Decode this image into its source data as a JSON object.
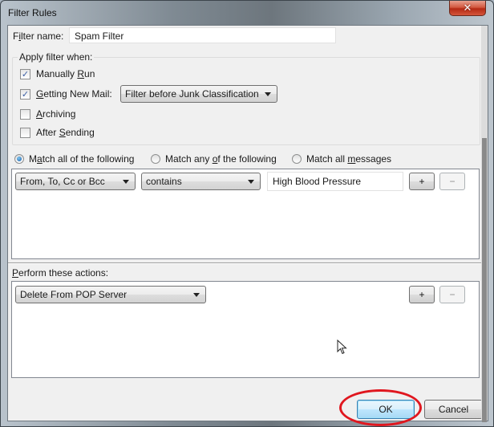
{
  "window": {
    "title": "Filter Rules",
    "close_icon": "close-x-icon",
    "close_glyph": "✕"
  },
  "filter_name": {
    "label_prefix": "F",
    "label_underlined": "i",
    "label_suffix": "lter name:",
    "value": "Spam Filter"
  },
  "apply_when": {
    "legend": "Apply filter when:",
    "options": [
      {
        "pre": "Manually ",
        "u": "R",
        "post": "un",
        "checked": true
      },
      {
        "pre": "",
        "u": "G",
        "post": "etting New Mail:",
        "checked": true
      },
      {
        "pre": "",
        "u": "A",
        "post": "rchiving",
        "checked": false
      },
      {
        "pre": "After ",
        "u": "S",
        "post": "ending",
        "checked": false
      }
    ],
    "new_mail_dropdown": "Filter before Junk Classification",
    "check_glyph": "✓"
  },
  "match": {
    "options": [
      {
        "pre": "M",
        "u": "a",
        "post": "tch all of the following",
        "selected": true
      },
      {
        "pre": "Match any ",
        "u": "o",
        "post": "f the following",
        "selected": false
      },
      {
        "pre": "Match all ",
        "u": "m",
        "post": "essages",
        "selected": false
      }
    ]
  },
  "rules": [
    {
      "field": "From, To, Cc or Bcc",
      "operator": "contains",
      "value": "High Blood Pressure",
      "add_label": "+",
      "remove_label": "−"
    }
  ],
  "actions": {
    "header_u": "P",
    "header_rest": "erform these actions:",
    "items": [
      {
        "action": "Delete From POP Server",
        "add_label": "+",
        "remove_label": "−"
      }
    ]
  },
  "footer": {
    "ok_label": "OK",
    "cancel_label": "Cancel"
  },
  "annotation": {
    "highlight_color": "#e0171f",
    "highlighted": "ok-button"
  }
}
